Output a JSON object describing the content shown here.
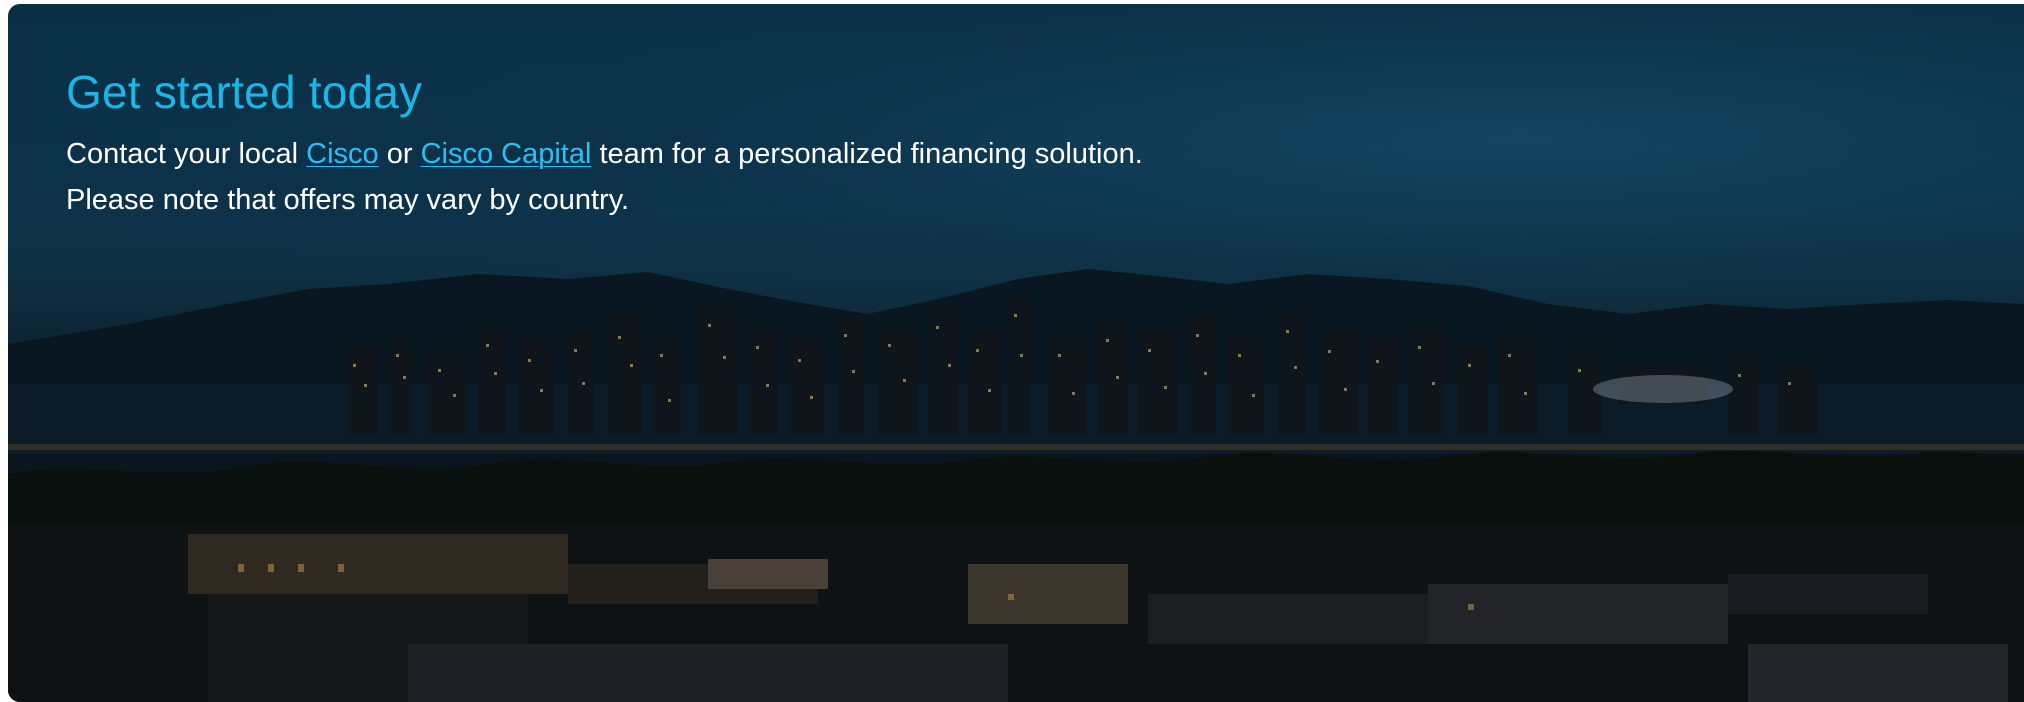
{
  "banner": {
    "title": "Get started today",
    "line1": {
      "before": "Contact your local ",
      "link1": "Cisco",
      "between": " or ",
      "link2": "Cisco Capital",
      "after": " team for a personalized financing solution."
    },
    "line2": "Please note that offers may vary by country."
  },
  "colors": {
    "title": "#19b6e8",
    "link": "#29c1f2",
    "text": "#ffffff"
  }
}
